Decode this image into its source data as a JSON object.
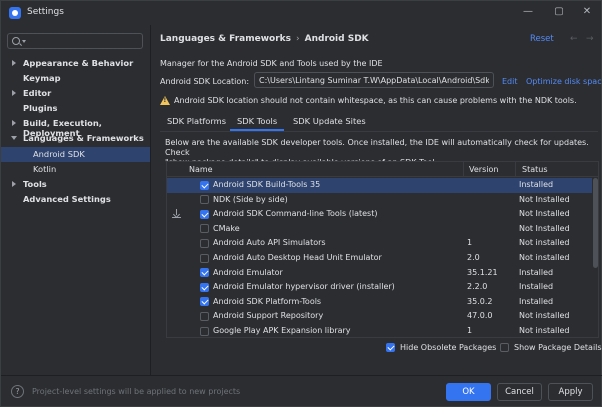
{
  "window": {
    "title": "Settings",
    "minimize": "—",
    "maximize": "▢",
    "close": "✕"
  },
  "sidebar": {
    "search_placeholder": "",
    "items": [
      {
        "label": "Appearance & Behavior",
        "chevron": "right",
        "bold": true
      },
      {
        "label": "Keymap",
        "chevron": "none",
        "bold": true
      },
      {
        "label": "Editor",
        "chevron": "right",
        "bold": true
      },
      {
        "label": "Plugins",
        "chevron": "none",
        "bold": true
      },
      {
        "label": "Build, Execution, Deployment",
        "chevron": "right",
        "bold": true
      },
      {
        "label": "Languages & Frameworks",
        "chevron": "down",
        "bold": true
      },
      {
        "label": "Android SDK",
        "chevron": "none",
        "bold": false,
        "selected": true
      },
      {
        "label": "Kotlin",
        "chevron": "none",
        "bold": false
      },
      {
        "label": "Tools",
        "chevron": "right",
        "bold": true
      },
      {
        "label": "Advanced Settings",
        "chevron": "none",
        "bold": true
      }
    ]
  },
  "header": {
    "breadcrumb_parent": "Languages & Frameworks",
    "breadcrumb_sep": "›",
    "breadcrumb_current": "Android SDK",
    "reset": "Reset",
    "back_arrow": "←",
    "forward_arrow": "→"
  },
  "main": {
    "description": "Manager for the Android SDK and Tools used by the IDE",
    "location_label": "Android SDK Location:",
    "location_value": "C:\\Users\\Lintang Suminar T.W\\AppData\\Local\\Android\\Sdk",
    "edit": "Edit",
    "optimize": "Optimize disk space",
    "warning": "Android SDK location should not contain whitespace, as this can cause problems with the NDK tools.",
    "tabs": [
      {
        "label": "SDK Platforms",
        "active": false
      },
      {
        "label": "SDK Tools",
        "active": true
      },
      {
        "label": "SDK Update Sites",
        "active": false
      }
    ],
    "below_text_1": "Below are the available SDK developer tools. Once installed, the IDE will automatically check for updates. Check",
    "below_text_2": "\"show package details\" to display available versions of an SDK Tool.",
    "table": {
      "columns": [
        "Name",
        "Version",
        "Status"
      ],
      "rows": [
        {
          "name": "Android SDK Build-Tools 35",
          "version": "",
          "status": "Installed",
          "checked": true,
          "selected": true,
          "download": false
        },
        {
          "name": "NDK (Side by side)",
          "version": "",
          "status": "Not Installed",
          "checked": false,
          "selected": false,
          "download": false
        },
        {
          "name": "Android SDK Command-line Tools (latest)",
          "version": "",
          "status": "Not Installed",
          "checked": true,
          "selected": false,
          "download": true
        },
        {
          "name": "CMake",
          "version": "",
          "status": "Not Installed",
          "checked": false,
          "selected": false,
          "download": false
        },
        {
          "name": "Android Auto API Simulators",
          "version": "1",
          "status": "Not installed",
          "checked": false,
          "selected": false,
          "download": false
        },
        {
          "name": "Android Auto Desktop Head Unit Emulator",
          "version": "2.0",
          "status": "Not installed",
          "checked": false,
          "selected": false,
          "download": false
        },
        {
          "name": "Android Emulator",
          "version": "35.1.21",
          "status": "Installed",
          "checked": true,
          "selected": false,
          "download": false
        },
        {
          "name": "Android Emulator hypervisor driver (installer)",
          "version": "2.2.0",
          "status": "Installed",
          "checked": true,
          "selected": false,
          "download": false
        },
        {
          "name": "Android SDK Platform-Tools",
          "version": "35.0.2",
          "status": "Installed",
          "checked": true,
          "selected": false,
          "download": false
        },
        {
          "name": "Android Support Repository",
          "version": "47.0.0",
          "status": "Not installed",
          "checked": false,
          "selected": false,
          "download": false
        },
        {
          "name": "Google Play APK Expansion library",
          "version": "1",
          "status": "Not installed",
          "checked": false,
          "selected": false,
          "download": false
        }
      ]
    },
    "hide_obsolete": {
      "label": "Hide Obsolete Packages",
      "checked": true
    },
    "show_details": {
      "label": "Show Package Details",
      "checked": false
    }
  },
  "footer": {
    "help": "?",
    "note": "Project-level settings will be applied to new projects",
    "ok": "OK",
    "cancel": "Cancel",
    "apply": "Apply"
  },
  "colors": {
    "accent": "#3574f0",
    "link": "#548af7",
    "selection": "#2e436e",
    "background": "#2b2d30",
    "warning": "#f2c55c"
  }
}
